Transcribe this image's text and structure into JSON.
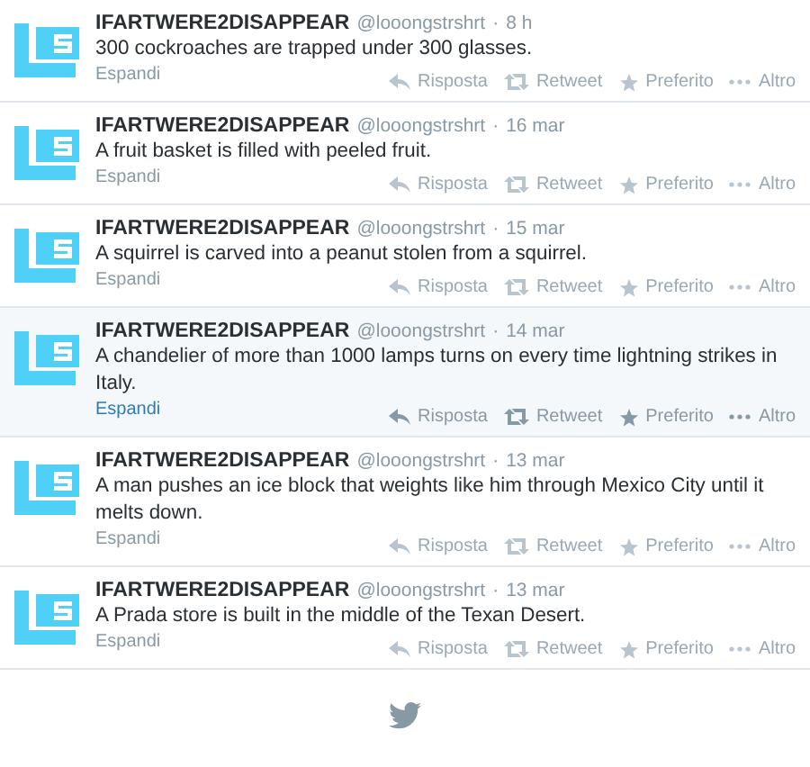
{
  "tweets": [
    {
      "name": "IFARTWERE2DISAPPEAR",
      "handle": "@looongstrshrt",
      "separator": "·",
      "time": "8 h",
      "text": "300 cockroaches are trapped under 300 glasses.",
      "expand": "Espandi",
      "actions": [
        "Risposta",
        "Retweet",
        "Preferito",
        "Altro"
      ],
      "hovered": false
    },
    {
      "name": "IFARTWERE2DISAPPEAR",
      "handle": "@looongstrshrt",
      "separator": "·",
      "time": "16 mar",
      "text": "A fruit basket is filled with peeled fruit.",
      "expand": "Espandi",
      "actions": [
        "Risposta",
        "Retweet",
        "Preferito",
        "Altro"
      ],
      "hovered": false
    },
    {
      "name": "IFARTWERE2DISAPPEAR",
      "handle": "@looongstrshrt",
      "separator": "·",
      "time": "15 mar",
      "text": "A squirrel is carved into a peanut stolen from a squirrel.",
      "expand": "Espandi",
      "actions": [
        "Risposta",
        "Retweet",
        "Preferito",
        "Altro"
      ],
      "hovered": false
    },
    {
      "name": "IFARTWERE2DISAPPEAR",
      "handle": "@looongstrshrt",
      "separator": "·",
      "time": "14 mar",
      "text": "A chandelier of more than 1000 lamps turns on every time lightning strikes in Italy.",
      "expand": "Espandi",
      "actions": [
        "Risposta",
        "Retweet",
        "Preferito",
        "Altro"
      ],
      "hovered": true
    },
    {
      "name": "IFARTWERE2DISAPPEAR",
      "handle": "@looongstrshrt",
      "separator": "·",
      "time": "13 mar",
      "text": "A man pushes an ice block that weights like him through Mexico City until it melts down.",
      "expand": "Espandi",
      "actions": [
        "Risposta",
        "Retweet",
        "Preferito",
        "Altro"
      ],
      "hovered": false
    },
    {
      "name": "IFARTWERE2DISAPPEAR",
      "handle": "@looongstrshrt",
      "separator": "·",
      "time": "13 mar",
      "text": "A Prada store is built in the middle of the Texan Desert.",
      "expand": "Espandi",
      "actions": [
        "Risposta",
        "Retweet",
        "Preferito",
        "Altro"
      ],
      "hovered": false
    }
  ]
}
